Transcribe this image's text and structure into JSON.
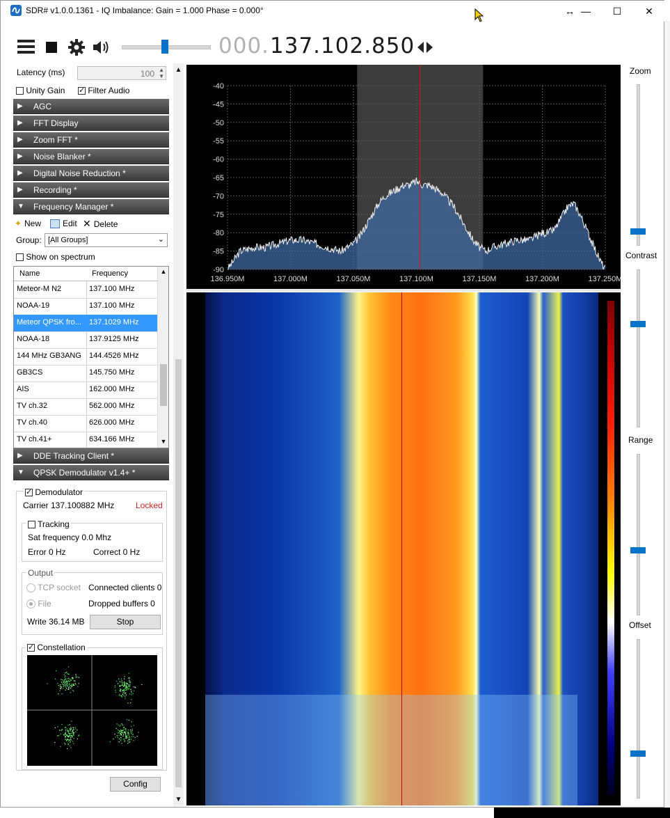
{
  "window": {
    "title": "SDR# v1.0.0.1361 - IQ Imbalance: Gain = 1.000 Phase = 0.000°",
    "caption_buttons": [
      "↔",
      "—",
      "☐",
      "✕"
    ]
  },
  "toolbar": {
    "frequency_dim": "000.",
    "frequency_main": "137.102.850",
    "volume_level": 0.48
  },
  "audio": {
    "latency_label": "Latency (ms)",
    "latency_value": "100",
    "unity_gain_label": "Unity Gain",
    "unity_gain_checked": false,
    "filter_audio_label": "Filter Audio",
    "filter_audio_checked": true
  },
  "sections": [
    {
      "label": "AGC",
      "expanded": false
    },
    {
      "label": "FFT Display",
      "expanded": false
    },
    {
      "label": "Zoom FFT *",
      "expanded": false
    },
    {
      "label": "Noise Blanker *",
      "expanded": false
    },
    {
      "label": "Digital Noise Reduction *",
      "expanded": false
    },
    {
      "label": "Recording *",
      "expanded": false
    },
    {
      "label": "Frequency Manager *",
      "expanded": true
    }
  ],
  "freq_manager": {
    "new_label": "New",
    "edit_label": "Edit",
    "delete_label": "Delete",
    "group_label": "Group:",
    "group_value": "[All Groups]",
    "show_on_spectrum_label": "Show on spectrum",
    "show_on_spectrum_checked": false,
    "col_name": "Name",
    "col_frequency": "Frequency",
    "rows": [
      {
        "name": "Meteor-M N2",
        "freq": "137.100 MHz",
        "selected": false
      },
      {
        "name": "NOAA-19",
        "freq": "137.100 MHz",
        "selected": false
      },
      {
        "name": "Meteor QPSK fro...",
        "freq": "137.1029 MHz",
        "selected": true
      },
      {
        "name": "NOAA-18",
        "freq": "137.9125 MHz",
        "selected": false
      },
      {
        "name": "144 MHz GB3ANG",
        "freq": "144.4526 MHz",
        "selected": false
      },
      {
        "name": "GB3CS",
        "freq": "145.750 MHz",
        "selected": false
      },
      {
        "name": "AIS",
        "freq": "162.000 MHz",
        "selected": false
      },
      {
        "name": "TV ch.32",
        "freq": "562.000 MHz",
        "selected": false
      },
      {
        "name": "TV ch.40",
        "freq": "626.000 MHz",
        "selected": false
      },
      {
        "name": "TV ch.41+",
        "freq": "634.166 MHz",
        "selected": false
      }
    ]
  },
  "sections2": [
    {
      "label": "DDE Tracking Client *",
      "expanded": false
    },
    {
      "label": "QPSK Demodulator v1.4+ *",
      "expanded": true
    }
  ],
  "qpsk": {
    "demodulator_label": "Demodulator",
    "demodulator_checked": true,
    "carrier_text": "Carrier 137.100882 MHz",
    "status_text": "Locked",
    "status_color": "#d21f1f",
    "tracking_label": "Tracking",
    "tracking_checked": false,
    "sat_frequency_text": "Sat frequency 0.0 Mhz",
    "error_text": "Error 0 Hz",
    "correct_text": "Correct 0 Hz",
    "output_label": "Output",
    "tcp_label": "TCP socket",
    "connected_text": "Connected clients 0",
    "file_label": "File",
    "dropped_text": "Dropped buffers 0",
    "write_text": "Write 36.14 MB",
    "stop_label": "Stop",
    "constellation_label": "Constellation",
    "constellation_checked": true,
    "config_label": "Config"
  },
  "right_sliders": {
    "zoom_label": "Zoom",
    "contrast_label": "Contrast",
    "range_label": "Range",
    "offset_label": "Offset",
    "zoom_level": 0.93,
    "contrast_level": 0.34,
    "range_level": 0.6,
    "offset_level": 0.73
  },
  "chart_data": {
    "type": "area",
    "title": "",
    "xlabel": "",
    "ylabel": "",
    "xlim": [
      136.95,
      137.25
    ],
    "ylim": [
      -90,
      -40
    ],
    "y_ticks": [
      "-40",
      "-45",
      "-50",
      "-55",
      "-60",
      "-65",
      "-70",
      "-75",
      "-80",
      "-85",
      "-90"
    ],
    "x_ticks": [
      "136.950M",
      "137.000M",
      "137.050M",
      "137.100M",
      "137.150M",
      "137.200M",
      "137.250M"
    ],
    "x_tick_values": [
      136.95,
      137.0,
      137.05,
      137.1,
      137.15,
      137.2,
      137.25
    ],
    "grid": true,
    "tuned_frequency": 137.1029,
    "passband": [
      137.0529,
      137.1529
    ],
    "series": [
      {
        "x": [
          136.95,
          136.96,
          136.97,
          136.98,
          136.99,
          137.0,
          137.01,
          137.02,
          137.03,
          137.04,
          137.05,
          137.055,
          137.06,
          137.065,
          137.07,
          137.075,
          137.08,
          137.085,
          137.09,
          137.095,
          137.1,
          137.105,
          137.11,
          137.115,
          137.12,
          137.125,
          137.13,
          137.135,
          137.14,
          137.145,
          137.15,
          137.155,
          137.16,
          137.17,
          137.18,
          137.19,
          137.2,
          137.205,
          137.21,
          137.215,
          137.22,
          137.225,
          137.23,
          137.235,
          137.24,
          137.245,
          137.25
        ],
        "values": [
          -90,
          -85,
          -84,
          -84,
          -83,
          -82,
          -82,
          -83,
          -84,
          -85,
          -83,
          -81,
          -78,
          -75,
          -72,
          -70,
          -69,
          -68,
          -67,
          -67,
          -66,
          -67,
          -67,
          -68,
          -69,
          -71,
          -73,
          -76,
          -79,
          -82,
          -84,
          -85,
          -84,
          -83,
          -82,
          -82,
          -80,
          -80,
          -79,
          -76,
          -73,
          -72,
          -75,
          -79,
          -83,
          -87,
          -90
        ]
      }
    ]
  }
}
